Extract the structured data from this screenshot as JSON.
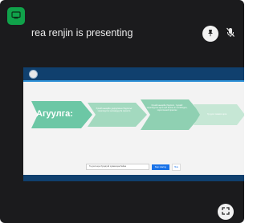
{
  "presenter": {
    "name_label": "rea renjin is presenting"
  },
  "controls": {
    "badge_icon": "screen-share-icon",
    "pin_icon": "pin-icon",
    "mute_icon": "mic-off-icon",
    "fullscreen_icon": "fullscreen-icon"
  },
  "slide": {
    "title": "Агуулга:",
    "steps": [
      "Хүний нөөцийн удирдлагын бодлогыг хэрэгжүүлэх алхамууд ба зорилго",
      "Хүний нөөцийн бодлого, түүнийг хэрэгжүүлэх арга зүй болон ач холбогдол, хэрэглээний практик",
      "Үр дүнг хэмжих арга"
    ]
  },
  "share_bar": {
    "message": "Та дэлгэцээ бусадтай хуваалцаж байна",
    "stop_label": "Stop sharing",
    "hide_label": "Hide"
  },
  "colors": {
    "tile_bg": "#1b1b1d",
    "badge_green": "#10a24a",
    "slide_header_blue": "#10406e",
    "arrow_green_dark": "#6cc7a5",
    "arrow_green_light": "#c6e7d5"
  }
}
